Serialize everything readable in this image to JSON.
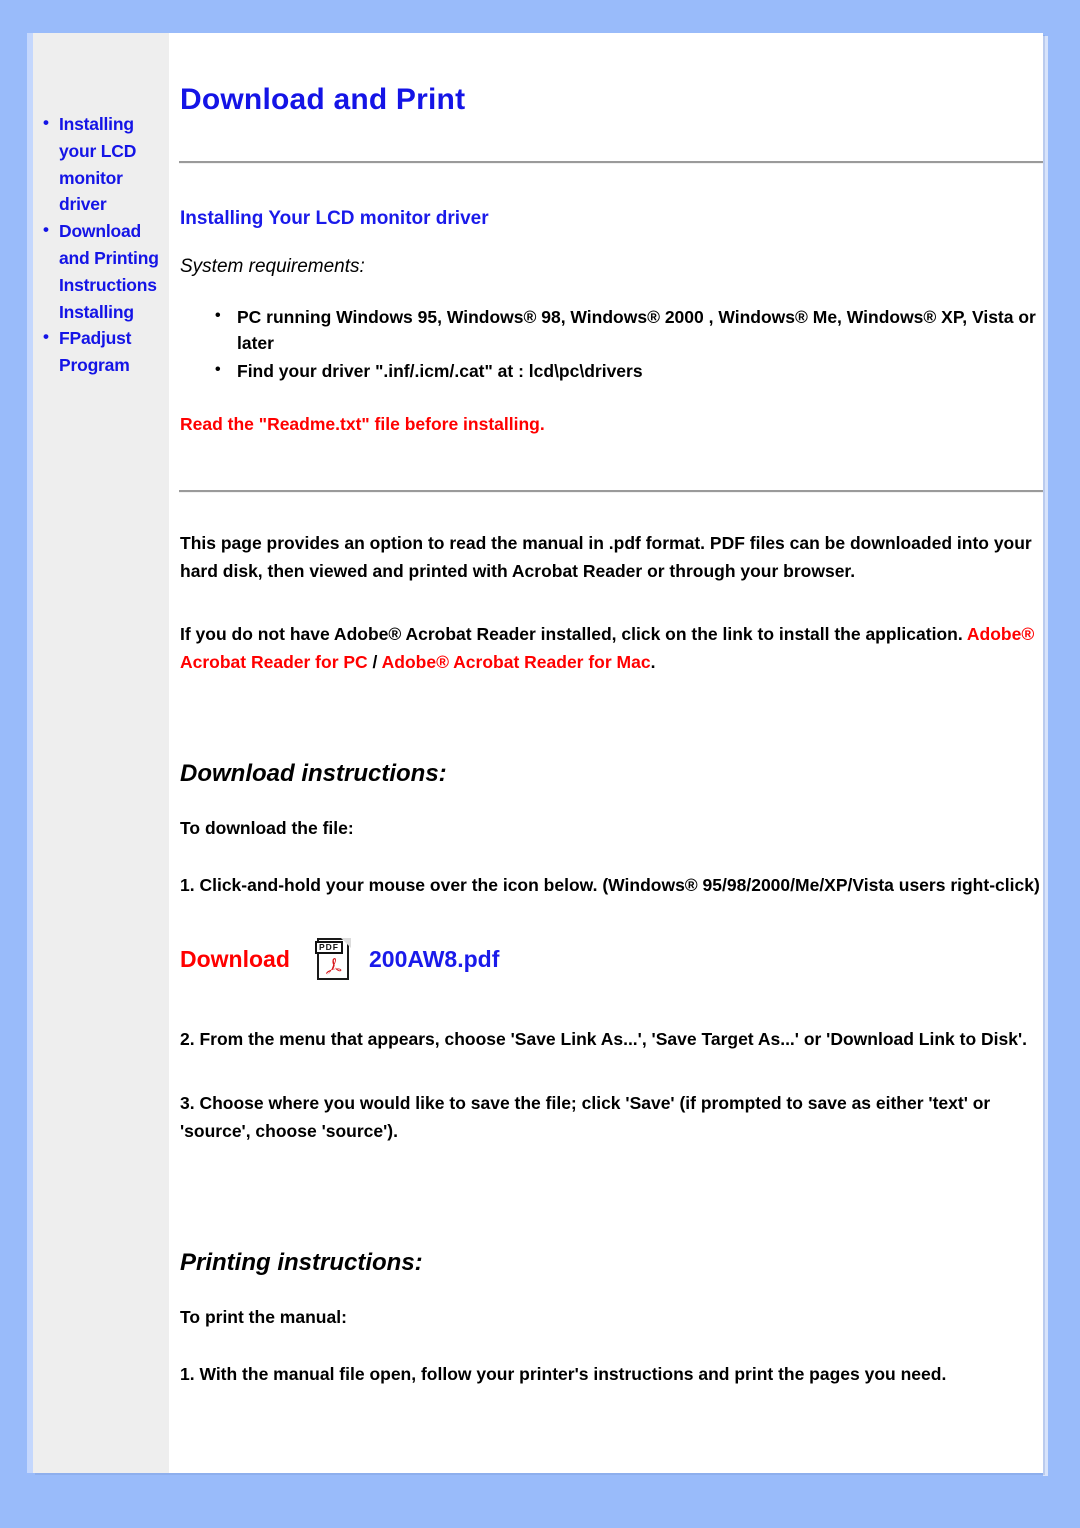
{
  "colors": {
    "page_background": "#99bbfa",
    "content_background": "#ffffff",
    "sidebar_background": "#eeeeee",
    "link_blue": "#1414e6",
    "accent_red": "#ff0000",
    "rule_gray": "#9a9a9a"
  },
  "sidebar": {
    "items": [
      {
        "label": "Installing your LCD monitor driver",
        "bullet": true
      },
      {
        "label": "Download and Printing Instructions",
        "bullet": true
      },
      {
        "label": "Installing",
        "bullet": false
      },
      {
        "label": "FPadjust Program",
        "bullet": true
      }
    ]
  },
  "main": {
    "title": "Download and Print",
    "section_heading": "Installing Your LCD monitor driver",
    "system_requirements_label": "System requirements:",
    "requirements": [
      "PC running Windows 95, Windows® 98, Windows® 2000 , Windows® Me, Windows® XP, Vista or later",
      "Find your driver \".inf/.icm/.cat\" at : lcd\\pc\\drivers"
    ],
    "readme_notice": "Read the \"Readme.txt\" file before installing.",
    "intro_paragraph": "This page provides an option to read the manual in .pdf format. PDF files can be downloaded into your hard disk, then viewed and printed with Acrobat Reader or through your browser.",
    "adobe_paragraph_prefix": "If you do not have Adobe® Acrobat Reader installed, click on the link to install the application. ",
    "adobe_link_pc": "Adobe® Acrobat Reader for PC",
    "adobe_link_separator": " / ",
    "adobe_link_mac": "Adobe® Acrobat Reader for Mac",
    "adobe_paragraph_suffix": ".",
    "download_instructions": {
      "heading": "Download instructions:",
      "lead": "To download the file:",
      "steps": [
        "1. Click-and-hold your mouse over the icon below. (Windows® 95/98/2000/Me/XP/Vista users right-click)",
        "2. From the menu that appears, choose 'Save Link As...', 'Save Target As...' or 'Download Link to Disk'.",
        "3. Choose where you would like to save the file; click 'Save' (if prompted to save as either 'text' or 'source', choose 'source')."
      ]
    },
    "download_row": {
      "label": "Download",
      "icon": "pdf-file-icon",
      "icon_tag_text": "PDF",
      "filename": "200AW8.pdf"
    },
    "printing_instructions": {
      "heading": "Printing instructions:",
      "lead": "To print the manual:",
      "steps": [
        "1. With the manual file open, follow your printer's instructions and print the pages you need."
      ]
    }
  }
}
